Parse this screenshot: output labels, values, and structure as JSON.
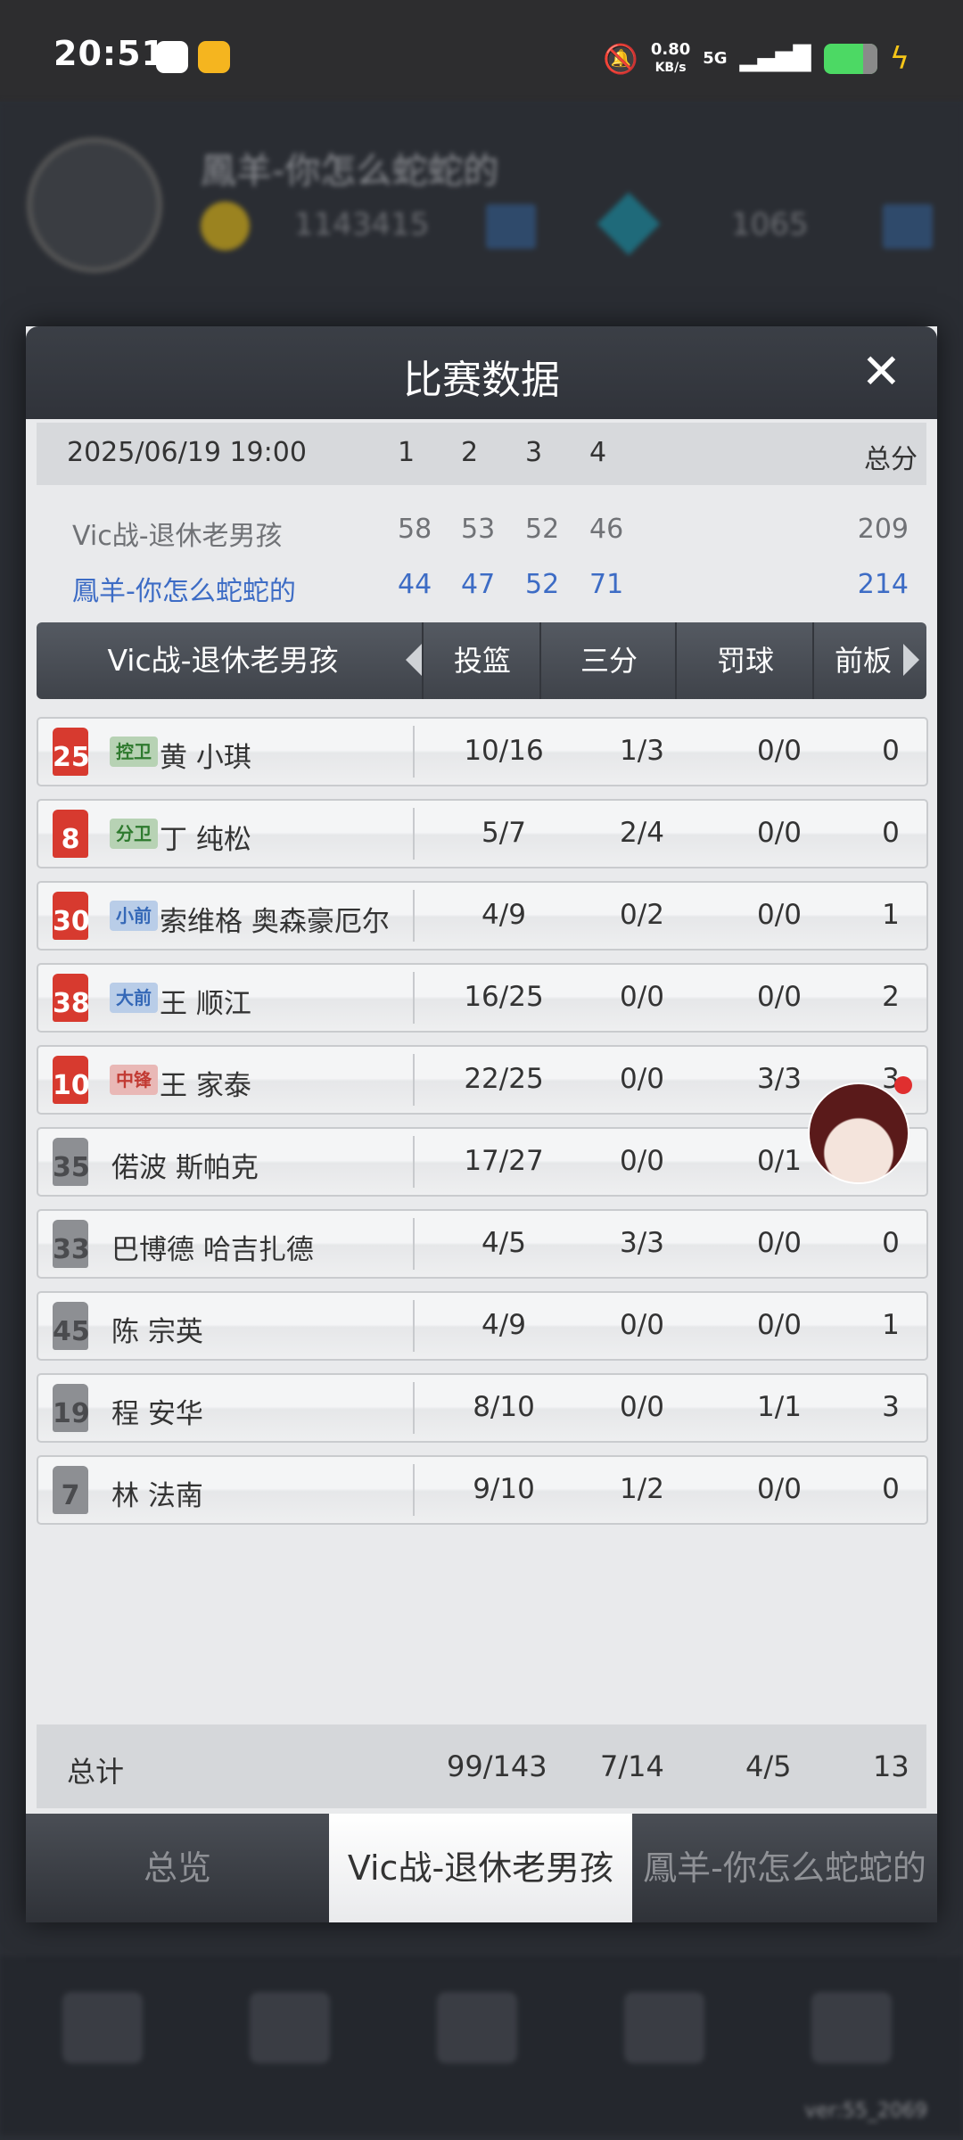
{
  "status_bar": {
    "time": "20:51",
    "speed_value": "0.80",
    "speed_unit": "KB/s",
    "network": "5G"
  },
  "background": {
    "player_name": "鳳羊-你怎么蛇蛇的",
    "coins": "1143415",
    "gems": "1065",
    "version": "ver:55_2069"
  },
  "modal": {
    "title": "比赛数据",
    "close_label": "✕",
    "score": {
      "date": "2025/06/19 19:00",
      "quarters": [
        "1",
        "2",
        "3",
        "4"
      ],
      "total_label": "总分",
      "team_a": {
        "name": "Vic战-退休老男孩",
        "q": [
          "58",
          "53",
          "52",
          "46"
        ],
        "total": "209"
      },
      "team_b": {
        "name": "鳳羊-你怎么蛇蛇的",
        "q": [
          "44",
          "47",
          "52",
          "71"
        ],
        "total": "214"
      }
    },
    "stats_tab": {
      "team": "Vic战-退休老男孩",
      "columns": [
        "投篮",
        "三分",
        "罚球",
        "前板"
      ]
    },
    "players": [
      {
        "number": "25",
        "jersey": "red",
        "position": "控卫",
        "pos_color": "green",
        "name": "黄 小琪",
        "fg": "10/16",
        "three": "1/3",
        "ft": "0/0",
        "oreb": "0"
      },
      {
        "number": "8",
        "jersey": "red",
        "position": "分卫",
        "pos_color": "green",
        "name": "丁 纯松",
        "fg": "5/7",
        "three": "2/4",
        "ft": "0/0",
        "oreb": "0"
      },
      {
        "number": "30",
        "jersey": "red",
        "position": "小前",
        "pos_color": "blue",
        "name": "索维格 奥森豪厄尔",
        "fg": "4/9",
        "three": "0/2",
        "ft": "0/0",
        "oreb": "1"
      },
      {
        "number": "38",
        "jersey": "red",
        "position": "大前",
        "pos_color": "blue",
        "name": "王 顺江",
        "fg": "16/25",
        "three": "0/0",
        "ft": "0/0",
        "oreb": "2"
      },
      {
        "number": "10",
        "jersey": "red",
        "position": "中锋",
        "pos_color": "red",
        "name": "王 家泰",
        "fg": "22/25",
        "three": "0/0",
        "ft": "3/3",
        "oreb": "3"
      },
      {
        "number": "35",
        "jersey": "grey",
        "position": "",
        "pos_color": "",
        "name": "偌波 斯帕克",
        "fg": "17/27",
        "three": "0/0",
        "ft": "0/1",
        "oreb": ""
      },
      {
        "number": "33",
        "jersey": "grey",
        "position": "",
        "pos_color": "",
        "name": "巴博德 哈吉扎德",
        "fg": "4/5",
        "three": "3/3",
        "ft": "0/0",
        "oreb": "0"
      },
      {
        "number": "45",
        "jersey": "grey",
        "position": "",
        "pos_color": "",
        "name": "陈 宗英",
        "fg": "4/9",
        "three": "0/0",
        "ft": "0/0",
        "oreb": "1"
      },
      {
        "number": "19",
        "jersey": "grey",
        "position": "",
        "pos_color": "",
        "name": "程 安华",
        "fg": "8/10",
        "three": "0/0",
        "ft": "1/1",
        "oreb": "3"
      },
      {
        "number": "7",
        "jersey": "grey",
        "position": "",
        "pos_color": "",
        "name": "林 法南",
        "fg": "9/10",
        "three": "1/2",
        "ft": "0/0",
        "oreb": "0"
      }
    ],
    "totals": {
      "label": "总计",
      "fg": "99/143",
      "three": "7/14",
      "ft": "4/5",
      "oreb": "13"
    },
    "bottom_tabs": [
      {
        "label": "总览",
        "active": false
      },
      {
        "label": "Vic战-退休老男孩",
        "active": true
      },
      {
        "label": "鳳羊-你怎么蛇蛇的",
        "active": false
      }
    ]
  }
}
